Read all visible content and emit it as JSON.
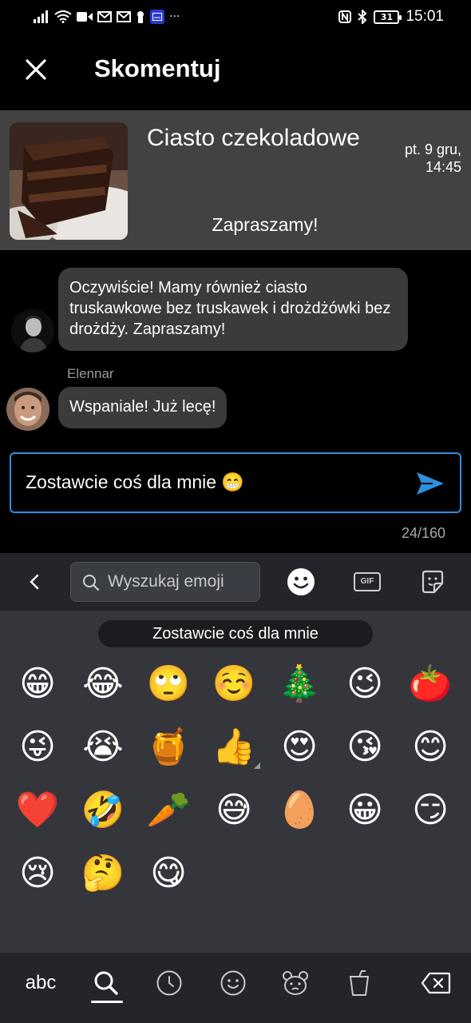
{
  "status_bar": {
    "time": "15:01",
    "battery": "31",
    "left_icons": [
      "signal-icon",
      "wifi-icon",
      "video-icon",
      "mail-icon",
      "mail-icon",
      "keyhole-icon",
      "calendar-badge-icon",
      "more-dots-icon"
    ],
    "right_icons": [
      "nfc-icon",
      "bluetooth-icon",
      "battery-icon"
    ],
    "more_dots": "···"
  },
  "header": {
    "title": "Skomentuj",
    "close_icon": "close-icon"
  },
  "post": {
    "title": "Ciasto czekoladowe",
    "date_line1": "pt. 9 gru,",
    "date_line2": "14:45",
    "message": "Zapraszamy!",
    "image": "chocolate-cake-photo"
  },
  "comments": [
    {
      "author": "",
      "text": "Oczywiście! Mamy również ciasto truskawkowe bez truskawek i drożdżówki bez drożdży. Zapraszamy!",
      "avatar": "man-bw-avatar"
    },
    {
      "author": "Elennar",
      "text": "Wspaniale! Już lecę!",
      "avatar": "smiling-man-avatar"
    }
  ],
  "input": {
    "value": "Zostawcie coś dla mnie 😁",
    "char_count": "24/160",
    "send_icon": "send-icon",
    "border_color": "#2e8fe0"
  },
  "keyboard": {
    "search_placeholder": "Wyszukaj emoji",
    "suggestion": "Zostawcie coś dla mnie",
    "toolbar_icons": [
      "back-icon",
      "emoji-icon",
      "gif-icon",
      "sticker-icon"
    ],
    "gif_label": "GIF",
    "emojis": [
      [
        "😁",
        "😂",
        "🙄",
        "☺️",
        "🎄",
        "😉",
        "🍅"
      ],
      [
        "😜",
        "😭",
        "🍯",
        "👍",
        "😍",
        "😘",
        "😊"
      ],
      [
        "❤️",
        "🤣",
        "🥕",
        "😅",
        "🥚",
        "😀",
        "😏"
      ],
      [
        "😢",
        "🤔",
        "😋"
      ]
    ],
    "bottom": {
      "abc_label": "abc",
      "icons": [
        "search-icon",
        "clock-icon",
        "smiley-icon",
        "bear-icon",
        "cup-icon",
        "backspace-icon"
      ]
    }
  },
  "colors": {
    "accent": "#2e8fe0",
    "bubble": "#3b3b3b",
    "post_card": "#424242",
    "keyboard_bg": "#34363c",
    "keyboard_bar": "#23252a"
  }
}
